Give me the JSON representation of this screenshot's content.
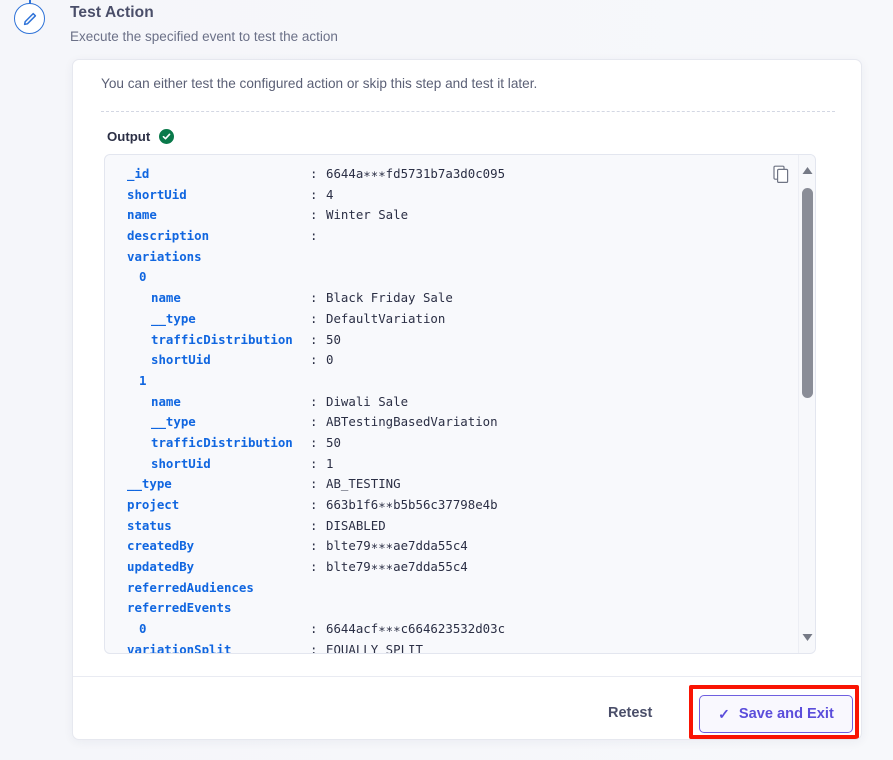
{
  "step": {
    "icon": "pencil-circle-icon",
    "accent_color": "#2f73d8"
  },
  "header": {
    "title": "Test Action",
    "subtitle": "Execute the specified event to test the action"
  },
  "card": {
    "intro": "You can either test the configured action or skip this step and test it later.",
    "output_label": "Output",
    "status_icon": "check-circle-icon",
    "status_color": "#09794a",
    "copy_icon": "copy-icon"
  },
  "output": {
    "key_color": "#1066e0",
    "value_color": "#2b2f45",
    "lines": [
      {
        "indent": 0,
        "key": "_id",
        "sep": ":",
        "value": "6644a∗∗∗fd5731b7a3d0c095"
      },
      {
        "indent": 0,
        "key": "shortUid",
        "sep": ":",
        "value": "4"
      },
      {
        "indent": 0,
        "key": "name",
        "sep": ":",
        "value": "Winter Sale"
      },
      {
        "indent": 0,
        "key": "description",
        "sep": ":",
        "value": ""
      },
      {
        "indent": 0,
        "key": "variations",
        "sep": "",
        "value": ""
      },
      {
        "indent": 1,
        "key": "0",
        "sep": "",
        "value": ""
      },
      {
        "indent": 2,
        "key": "name",
        "sep": ":",
        "value": "Black Friday Sale"
      },
      {
        "indent": 2,
        "key": "__type",
        "sep": ":",
        "value": "DefaultVariation"
      },
      {
        "indent": 2,
        "key": "trafficDistribution",
        "sep": ":",
        "value": "50"
      },
      {
        "indent": 2,
        "key": "shortUid",
        "sep": ":",
        "value": "0"
      },
      {
        "indent": 1,
        "key": "1",
        "sep": "",
        "value": ""
      },
      {
        "indent": 2,
        "key": "name",
        "sep": ":",
        "value": "Diwali Sale"
      },
      {
        "indent": 2,
        "key": "__type",
        "sep": ":",
        "value": "ABTestingBasedVariation"
      },
      {
        "indent": 2,
        "key": "trafficDistribution",
        "sep": ":",
        "value": "50"
      },
      {
        "indent": 2,
        "key": "shortUid",
        "sep": ":",
        "value": "1"
      },
      {
        "indent": 0,
        "key": "__type",
        "sep": ":",
        "value": "AB_TESTING"
      },
      {
        "indent": 0,
        "key": "project",
        "sep": ":",
        "value": "663b1f6∗∗b5b56c37798e4b"
      },
      {
        "indent": 0,
        "key": "status",
        "sep": ":",
        "value": "DISABLED"
      },
      {
        "indent": 0,
        "key": "createdBy",
        "sep": ":",
        "value": "blte79∗∗∗ae7dda55c4"
      },
      {
        "indent": 0,
        "key": "updatedBy",
        "sep": ":",
        "value": "blte79∗∗∗ae7dda55c4"
      },
      {
        "indent": 0,
        "key": "referredAudiences",
        "sep": "",
        "value": ""
      },
      {
        "indent": 0,
        "key": "referredEvents",
        "sep": "",
        "value": ""
      },
      {
        "indent": 1,
        "key": "0",
        "sep": ":",
        "value": "6644acf∗∗∗c664623532d03c"
      },
      {
        "indent": 0,
        "key": "variationSplit",
        "sep": ":",
        "value": "EQUALLY_SPLIT"
      }
    ]
  },
  "footer": {
    "retest_label": "Retest",
    "save_label": "Save and Exit",
    "save_tick": "✓",
    "save_accent": "#5b4ddb",
    "highlight_color": "#f91403"
  }
}
